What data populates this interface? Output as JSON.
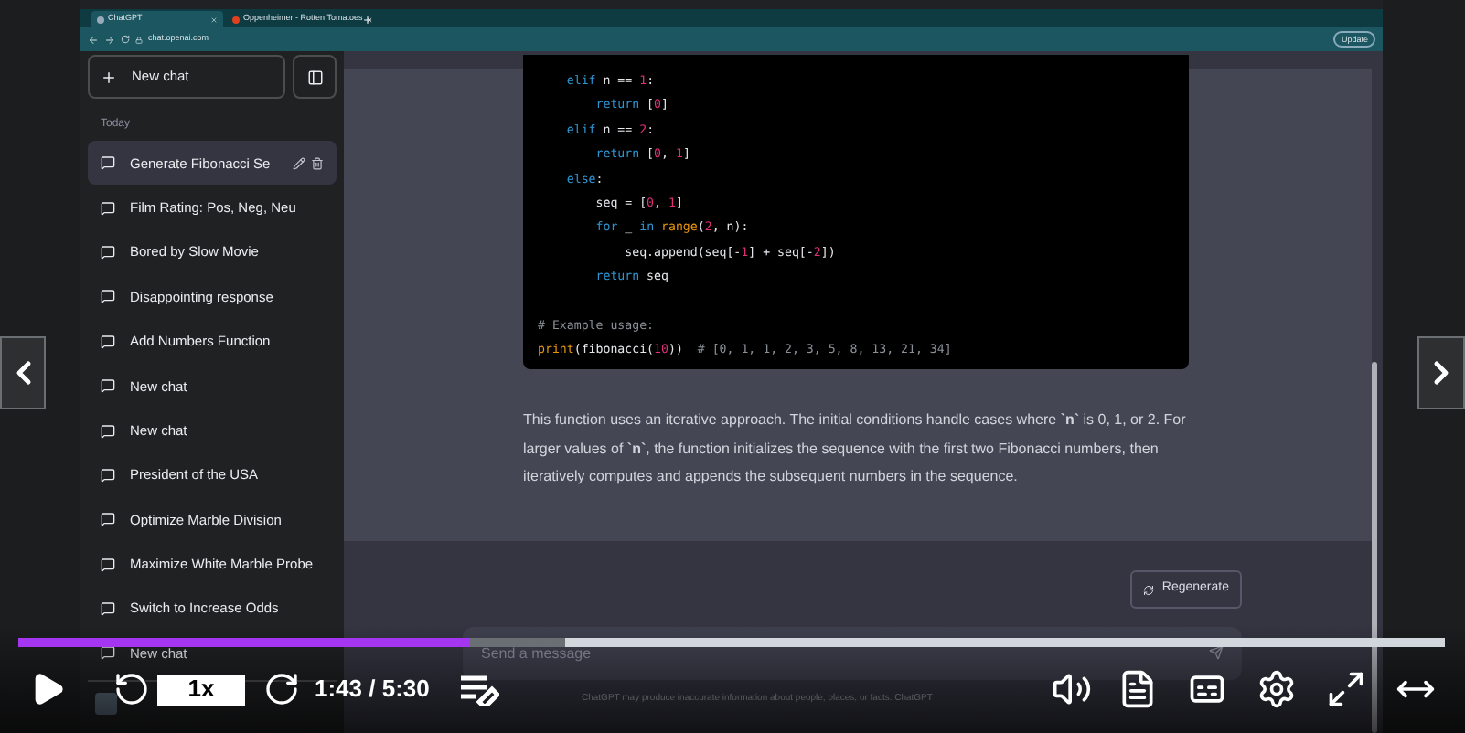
{
  "browser": {
    "tabs": [
      {
        "label": "ChatGPT",
        "selected": true
      },
      {
        "label": "Oppenheimer - Rotten Tomatoes",
        "selected": false
      }
    ],
    "url": "chat.openai.com",
    "update_button": "Update"
  },
  "sidebar": {
    "new_chat": "New chat",
    "section": "Today",
    "items": [
      {
        "label": "Generate Fibonacci Se",
        "selected": true
      },
      {
        "label": "Film Rating: Pos, Neg, Neu",
        "selected": false
      },
      {
        "label": "Bored by Slow Movie",
        "selected": false
      },
      {
        "label": "Disappointing response",
        "selected": false
      },
      {
        "label": "Add Numbers Function",
        "selected": false
      },
      {
        "label": "New chat",
        "selected": false
      },
      {
        "label": "New chat",
        "selected": false
      },
      {
        "label": "President of the USA",
        "selected": false
      },
      {
        "label": "Optimize Marble Division",
        "selected": false
      },
      {
        "label": "Maximize White Marble Probe",
        "selected": false
      },
      {
        "label": "Switch to Increase Odds",
        "selected": false
      },
      {
        "label": "New chat",
        "selected": false
      }
    ]
  },
  "code": {
    "lines": [
      {
        "tokens": [
          {
            "text": "    elif",
            "kind": "keyword"
          },
          {
            "text": " n == ",
            "kind": "plain"
          },
          {
            "text": "1",
            "kind": "number"
          },
          {
            "text": ":",
            "kind": "plain"
          }
        ]
      },
      {
        "tokens": [
          {
            "text": "        return",
            "kind": "keyword"
          },
          {
            "text": " [",
            "kind": "plain"
          },
          {
            "text": "0",
            "kind": "number"
          },
          {
            "text": "]",
            "kind": "plain"
          }
        ]
      },
      {
        "tokens": [
          {
            "text": "    elif",
            "kind": "keyword"
          },
          {
            "text": " n == ",
            "kind": "plain"
          },
          {
            "text": "2",
            "kind": "number"
          },
          {
            "text": ":",
            "kind": "plain"
          }
        ]
      },
      {
        "tokens": [
          {
            "text": "        return",
            "kind": "keyword"
          },
          {
            "text": " [",
            "kind": "plain"
          },
          {
            "text": "0",
            "kind": "number"
          },
          {
            "text": ", ",
            "kind": "plain"
          },
          {
            "text": "1",
            "kind": "number"
          },
          {
            "text": "]",
            "kind": "plain"
          }
        ]
      },
      {
        "tokens": [
          {
            "text": "    else",
            "kind": "keyword"
          },
          {
            "text": ":",
            "kind": "plain"
          }
        ]
      },
      {
        "tokens": [
          {
            "text": "        seq = [",
            "kind": "plain"
          },
          {
            "text": "0",
            "kind": "number"
          },
          {
            "text": ", ",
            "kind": "plain"
          },
          {
            "text": "1",
            "kind": "number"
          },
          {
            "text": "]",
            "kind": "plain"
          }
        ]
      },
      {
        "tokens": [
          {
            "text": "        for",
            "kind": "keyword"
          },
          {
            "text": " _ ",
            "kind": "plain"
          },
          {
            "text": "in",
            "kind": "keyword"
          },
          {
            "text": " range",
            "kind": "builtin"
          },
          {
            "text": "(",
            "kind": "plain"
          },
          {
            "text": "2",
            "kind": "number"
          },
          {
            "text": ", n):",
            "kind": "plain"
          }
        ]
      },
      {
        "tokens": [
          {
            "text": "            seq.append(seq[-",
            "kind": "plain"
          },
          {
            "text": "1",
            "kind": "number"
          },
          {
            "text": "] + seq[-",
            "kind": "plain"
          },
          {
            "text": "2",
            "kind": "number"
          },
          {
            "text": "])",
            "kind": "plain"
          }
        ]
      },
      {
        "tokens": [
          {
            "text": "        return",
            "kind": "keyword"
          },
          {
            "text": " seq",
            "kind": "plain"
          }
        ]
      },
      {
        "gap_before": true,
        "tokens": [
          {
            "text": "# Example usage:",
            "kind": "comment"
          }
        ]
      },
      {
        "tokens": [
          {
            "text": "print",
            "kind": "builtin"
          },
          {
            "text": "(fibonacci(",
            "kind": "plain"
          },
          {
            "text": "10",
            "kind": "number"
          },
          {
            "text": "))  ",
            "kind": "plain"
          },
          {
            "text": "# [0, 1, 1, 2, 3, 5, 8, 13, 21, 34]",
            "kind": "comment"
          }
        ]
      }
    ]
  },
  "explanation": "This function uses an iterative approach. The initial conditions handle cases where **`n`** is 0, 1, or 2. For larger values of **`n`**, the function initializes the sequence with the first two Fibonacci numbers, then iteratively computes and appends the subsequent numbers in the sequence.",
  "regenerate_button": "Regenerate",
  "message_input": {
    "placeholder": "Send a message"
  },
  "disclaimer": "ChatGPT may produce inaccurate information about people, places, or facts. ChatGPT",
  "player": {
    "progress": {
      "level": 0.317
    },
    "buffered": {
      "level": 0.383
    },
    "speed": "1x",
    "time": "1:43 / 5:30"
  }
}
